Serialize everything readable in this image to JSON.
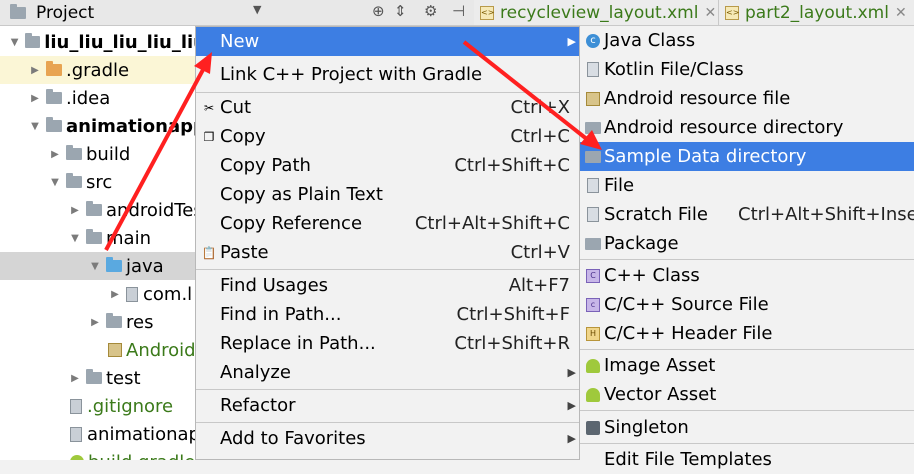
{
  "topbar": {
    "panel_title": "Project",
    "tabs": [
      {
        "label": "recycleview_layout.xml"
      },
      {
        "label": "part2_layout.xml"
      }
    ]
  },
  "tree": {
    "items": [
      {
        "label": "liu_liu_liu_liu_liu"
      },
      {
        "label": ".gradle"
      },
      {
        "label": ".idea"
      },
      {
        "label": "animationapp"
      },
      {
        "label": "build"
      },
      {
        "label": "src"
      },
      {
        "label": "androidTest"
      },
      {
        "label": "main"
      },
      {
        "label": "java"
      },
      {
        "label": "com.l"
      },
      {
        "label": "res"
      },
      {
        "label": "Android"
      },
      {
        "label": "test"
      },
      {
        "label": ".gitignore"
      },
      {
        "label": "animationap"
      },
      {
        "label": "build.gradle"
      }
    ]
  },
  "context_menu": {
    "items": [
      {
        "label": "New",
        "shortcut": ""
      },
      {
        "label": "Link C++ Project with Gradle",
        "shortcut": ""
      },
      {
        "label": "Cut",
        "shortcut": "Ctrl+X"
      },
      {
        "label": "Copy",
        "shortcut": "Ctrl+C"
      },
      {
        "label": "Copy Path",
        "shortcut": "Ctrl+Shift+C"
      },
      {
        "label": "Copy as Plain Text",
        "shortcut": ""
      },
      {
        "label": "Copy Reference",
        "shortcut": "Ctrl+Alt+Shift+C"
      },
      {
        "label": "Paste",
        "shortcut": "Ctrl+V"
      },
      {
        "label": "Find Usages",
        "shortcut": "Alt+F7"
      },
      {
        "label": "Find in Path...",
        "shortcut": "Ctrl+Shift+F"
      },
      {
        "label": "Replace in Path...",
        "shortcut": "Ctrl+Shift+R"
      },
      {
        "label": "Analyze",
        "shortcut": ""
      },
      {
        "label": "Refactor",
        "shortcut": ""
      },
      {
        "label": "Add to Favorites",
        "shortcut": ""
      }
    ]
  },
  "new_submenu": {
    "items": [
      {
        "label": "Java Class",
        "shortcut": ""
      },
      {
        "label": "Kotlin File/Class",
        "shortcut": ""
      },
      {
        "label": "Android resource file",
        "shortcut": ""
      },
      {
        "label": "Android resource directory",
        "shortcut": ""
      },
      {
        "label": "Sample Data directory",
        "shortcut": ""
      },
      {
        "label": "File",
        "shortcut": ""
      },
      {
        "label": "Scratch File",
        "shortcut": "Ctrl+Alt+Shift+Insert"
      },
      {
        "label": "Package",
        "shortcut": ""
      },
      {
        "label": "C++ Class",
        "shortcut": ""
      },
      {
        "label": "C/C++ Source File",
        "shortcut": ""
      },
      {
        "label": "C/C++ Header File",
        "shortcut": ""
      },
      {
        "label": "Image Asset",
        "shortcut": ""
      },
      {
        "label": "Vector Asset",
        "shortcut": ""
      },
      {
        "label": "Singleton",
        "shortcut": ""
      },
      {
        "label": "Edit File Templates",
        "shortcut": ""
      }
    ]
  },
  "colors": {
    "highlight": "#3d7ee3",
    "selected_row": "#d5d5d5",
    "annotation_arrow": "#ff2020",
    "file_green": "#3b7a1a"
  }
}
